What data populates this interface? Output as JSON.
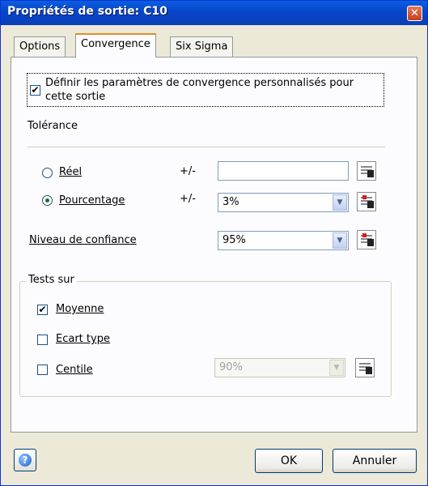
{
  "window": {
    "title": "Propriétés de sortie: C10",
    "close_glyph": "✕"
  },
  "tabs": [
    {
      "label": "Options"
    },
    {
      "label": "Convergence"
    },
    {
      "label": "Six Sigma"
    }
  ],
  "convergence": {
    "custom_checkbox": {
      "checked": true,
      "line1": "Définir les paramètres de convergence personnalisés pour",
      "line2": "cette sortie"
    },
    "tolerance_label": "Tolérance",
    "reel": {
      "label": "Réel",
      "plusminus": "+/-",
      "value": "",
      "selected": false
    },
    "pourcentage": {
      "label": "Pourcentage",
      "plusminus": "+/-",
      "value": "3%",
      "selected": true
    },
    "confidence": {
      "label": "Niveau de confiance",
      "value": "95%"
    },
    "tests": {
      "label": "Tests sur",
      "moyenne": {
        "label": "Moyenne",
        "checked": true
      },
      "ecart": {
        "label": "Ecart type",
        "checked": false
      },
      "centile": {
        "label": "Centile",
        "checked": false,
        "value": "90%"
      }
    }
  },
  "footer": {
    "help_glyph": "?",
    "ok": "OK",
    "cancel": "Annuler"
  },
  "colors": {
    "title_bar": "#0845c8",
    "tab_highlight": "#e68b2c",
    "dialog_bg": "#ece9d8"
  },
  "icons": {
    "check": "✔",
    "dropdown": "▼"
  }
}
